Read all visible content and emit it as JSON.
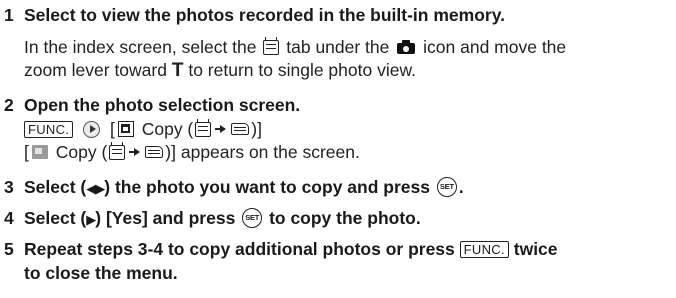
{
  "steps": [
    {
      "number": "1",
      "heading": "Select to view the photos recorded in the built-in memory.",
      "body_parts": {
        "a": "In the index screen, select the",
        "b": "tab under the",
        "c": "icon and move the",
        "d": "zoom lever toward",
        "t_glyph": "T",
        "e": "to return to single photo view."
      }
    },
    {
      "number": "2",
      "heading": "Open the photo selection screen.",
      "menu_line": {
        "func_label": "FUNC.",
        "open_bracket": "[",
        "copy_text": "Copy (",
        "close_text": ")]"
      },
      "result_line": {
        "open_bracket": "[",
        "copy_text": "Copy (",
        "close_text": ")] appears on the screen."
      }
    },
    {
      "number": "3",
      "heading_a": "Select (",
      "arrows": "◀▶",
      "heading_b": ") the photo you want to copy and press",
      "set_label": "SET",
      "heading_c": "."
    },
    {
      "number": "4",
      "heading_a": "Select (",
      "arrow": "▶",
      "heading_b": ") [Yes] and press",
      "set_label": "SET",
      "heading_c": "to copy the photo."
    },
    {
      "number": "5",
      "heading_a": "Repeat steps 3-4 to copy additional photos or press",
      "func_label": "FUNC.",
      "heading_b": "twice",
      "heading_line2": "to close the menu."
    }
  ],
  "icons": {
    "memory": "built-in-memory-icon",
    "camera": "camera-icon",
    "next": "next-arrow-icon",
    "copy": "copy-icon",
    "card": "memory-card-icon",
    "set": "set-button-icon"
  }
}
